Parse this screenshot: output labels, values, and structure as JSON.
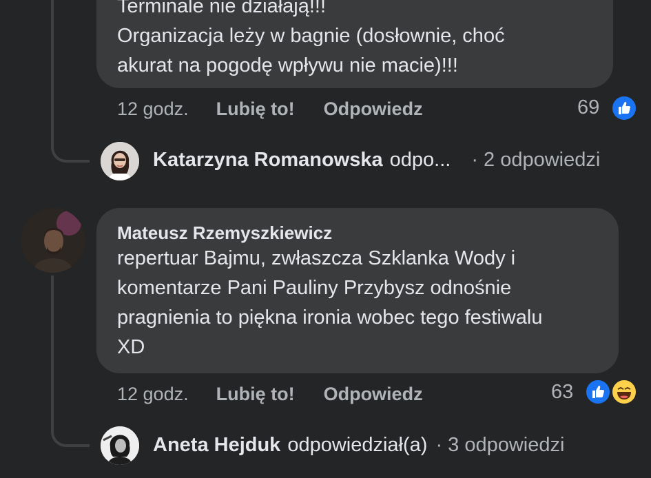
{
  "comment1": {
    "lines": [
      "Terminale nie działają!!!",
      "Organizacja leży w bagnie (dosłownie, choć",
      "akurat na pogodę wpływu nie macie)!!!"
    ],
    "time": "12 godz.",
    "like_label": "Lubię to!",
    "reply_label": "Odpowiedz",
    "reaction_count": "69",
    "reactions": [
      "like-icon"
    ]
  },
  "reply_summary1": {
    "name": "Katarzyna Romanowska",
    "verb": "odpo...",
    "count": "· 2 odpowiedzi"
  },
  "comment2": {
    "author": "Mateusz Rzemyszkiewicz",
    "lines": [
      "repertuar Bajmu, zwłaszcza Szklanka Wody i",
      "komentarze Pani Pauliny Przybysz odnośnie",
      "pragnienia to piękna ironia wobec tego festiwalu",
      "XD"
    ],
    "time": "12 godz.",
    "like_label": "Lubię to!",
    "reply_label": "Odpowiedz",
    "reaction_count": "63",
    "reactions": [
      "like-icon",
      "haha-icon"
    ]
  },
  "reply_summary2": {
    "name": "Aneta Hejduk",
    "verb": "odpowiedział(a)",
    "count": "· 3 odpowiedzi"
  },
  "colors": {
    "background": "#242526",
    "bubble": "#3a3b3c",
    "like_blue": "#1a74f2",
    "haha_yellow": "#fdd14b",
    "secondary_text": "#b0b3b8"
  }
}
